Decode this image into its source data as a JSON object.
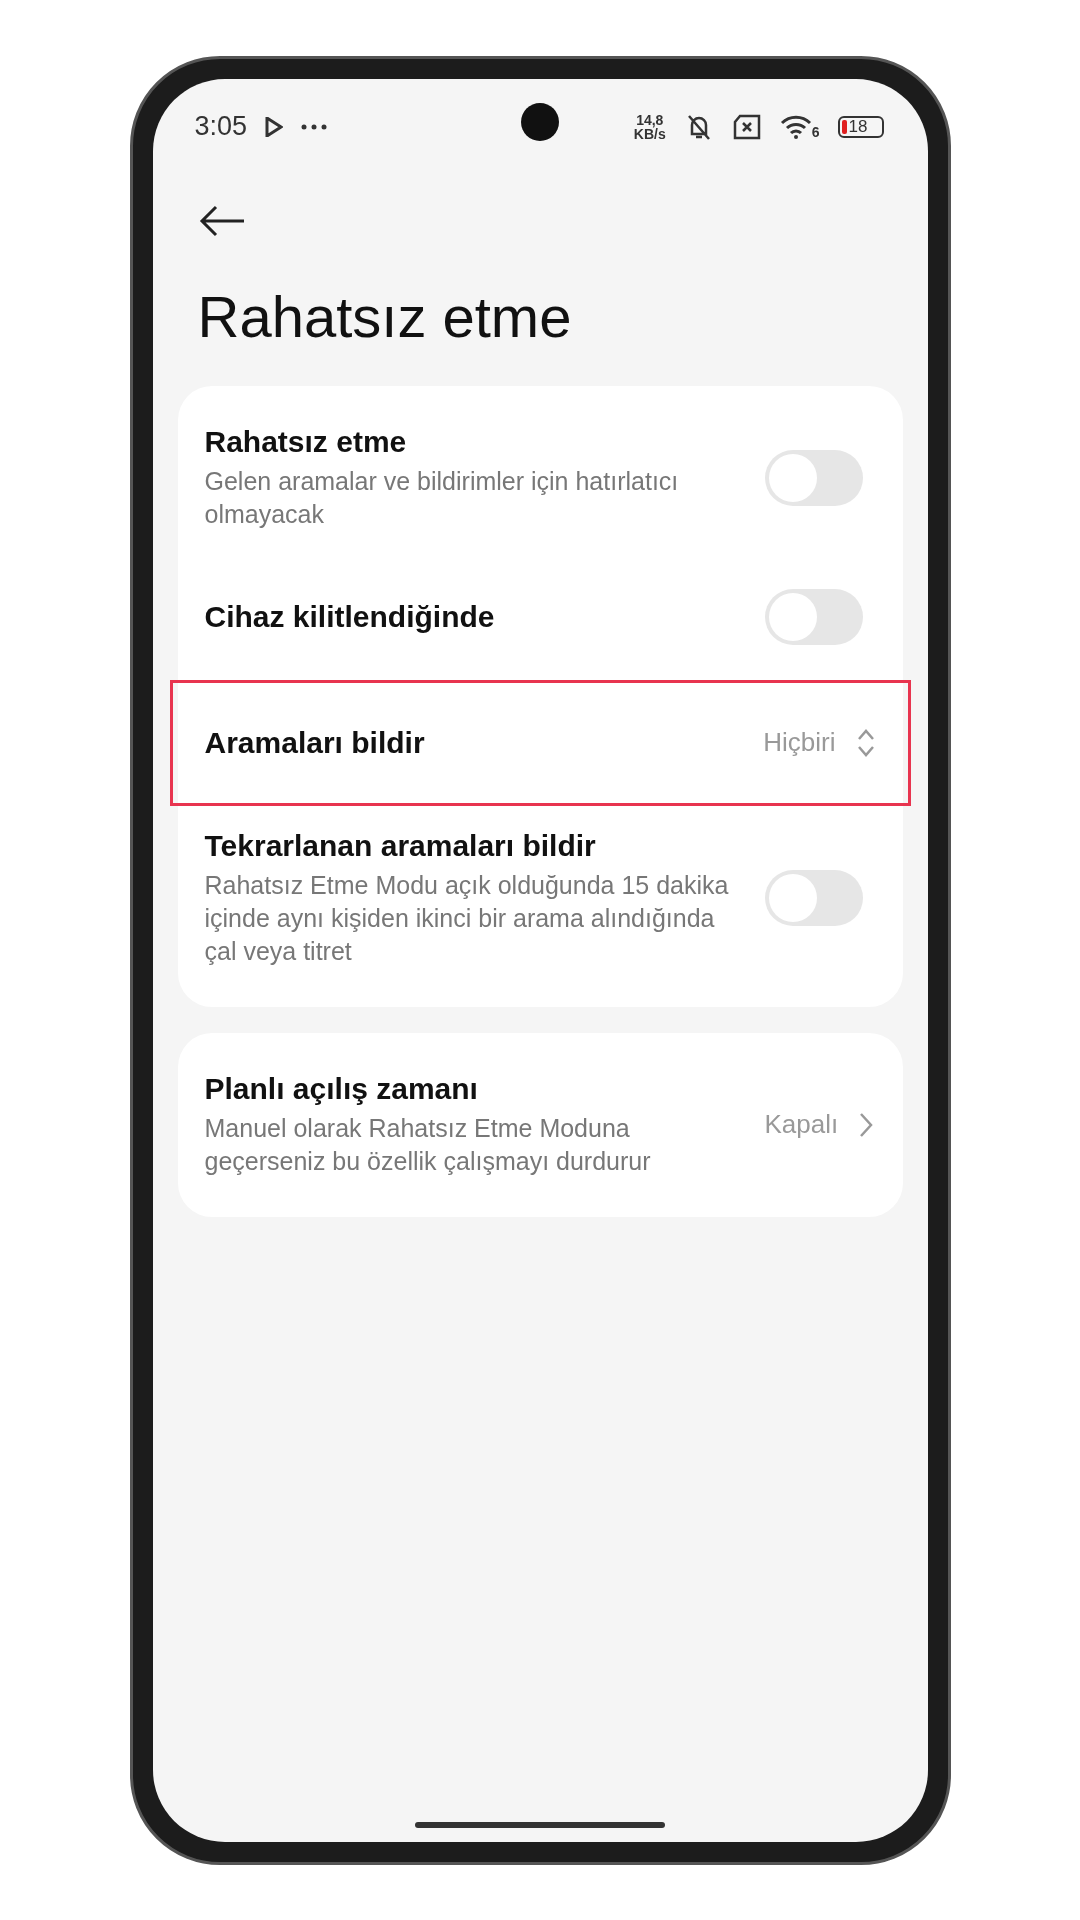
{
  "status_bar": {
    "time": "3:05",
    "net_speed": "14,8",
    "net_unit": "KB/s",
    "wifi_label": "6",
    "battery": "18"
  },
  "title": "Rahatsız etme",
  "groups": [
    {
      "items": [
        {
          "kind": "toggle",
          "title": "Rahatsız etme",
          "subtitle": "Gelen aramalar ve bildirimler için hatırlatıcı olmayacak",
          "on": false,
          "highlighted": false
        },
        {
          "kind": "toggle",
          "title": "Cihaz kilitlendiğinde",
          "on": false,
          "highlighted": false
        },
        {
          "kind": "select",
          "title": "Aramaları bildir",
          "value": "Hiçbiri",
          "highlighted": true
        },
        {
          "kind": "toggle",
          "title": "Tekrarlanan aramaları bildir",
          "subtitle": "Rahatsız Etme Modu açık olduğunda 15 dakika içinde aynı kişiden ikinci bir arama alındığında çal veya titret",
          "on": false,
          "highlighted": false
        }
      ]
    },
    {
      "items": [
        {
          "kind": "link",
          "title": "Planlı açılış zamanı",
          "subtitle": "Manuel olarak Rahatsız Etme Moduna geçerseniz bu özellik çalışmayı durdurur",
          "value": "Kapalı",
          "highlighted": false
        }
      ]
    }
  ]
}
